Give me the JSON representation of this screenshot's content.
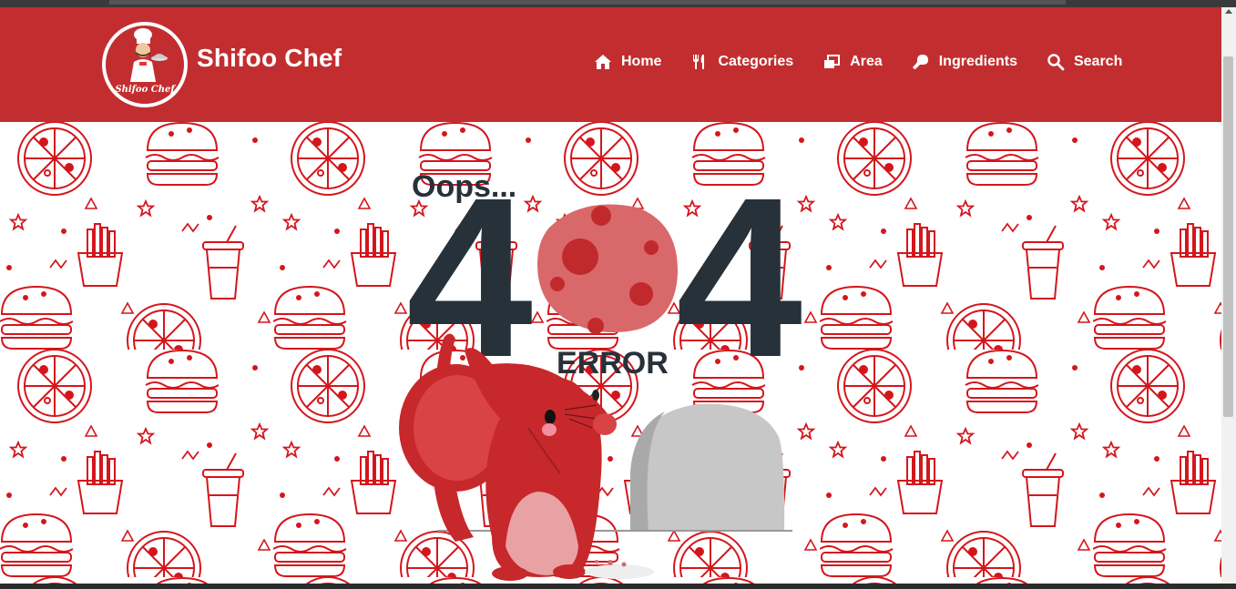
{
  "brand": {
    "name": "Shifoo Chef",
    "logo_text": "Shifoo Chef"
  },
  "nav": {
    "items": [
      {
        "label": "Home",
        "icon": "home-icon"
      },
      {
        "label": "Categories",
        "icon": "utensils-icon"
      },
      {
        "label": "Area",
        "icon": "windows-icon"
      },
      {
        "label": "Ingredients",
        "icon": "drumstick-icon"
      },
      {
        "label": "Search",
        "icon": "search-icon"
      }
    ]
  },
  "error_page": {
    "oops": "Oops...",
    "digit_left": "4",
    "digit_right": "4",
    "error_label": "ERROR"
  },
  "colors": {
    "brand_red": "#c22e30",
    "dark_text": "#27313a",
    "pattern_red": "#d4161c"
  }
}
